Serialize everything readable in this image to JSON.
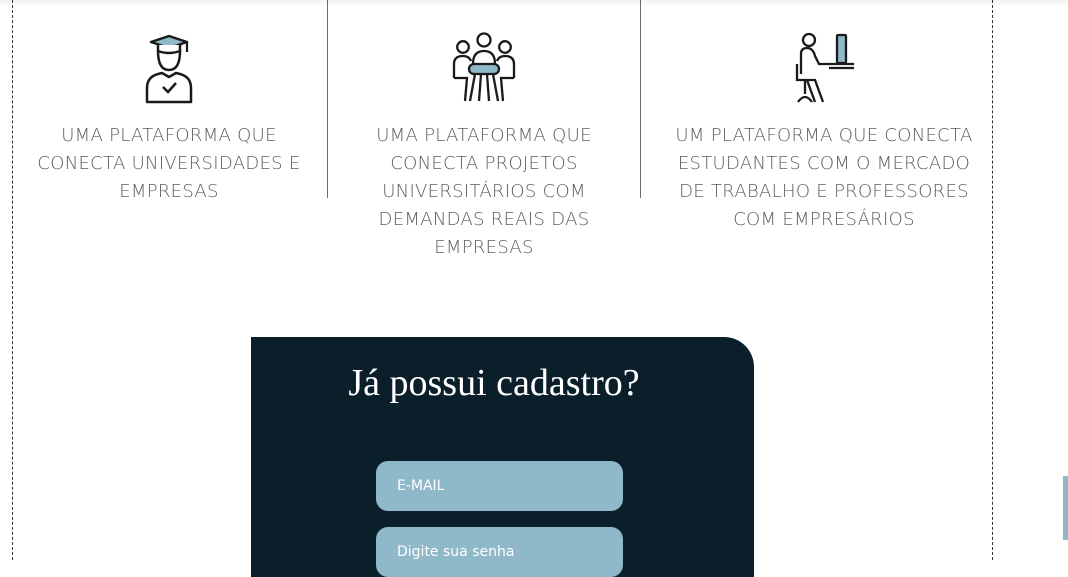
{
  "features": [
    {
      "icon": "graduate-icon",
      "text": "UMA PLATAFORMA QUE CONECTA UNIVERSIDADES E EMPRESAS"
    },
    {
      "icon": "meeting-group-icon",
      "text": "UMA PLATAFORMA QUE CONECTA PROJETOS UNIVERSITÁRIOS COM DEMANDAS REAIS DAS EMPRESAS"
    },
    {
      "icon": "desk-worker-icon",
      "text": "UM PLATAFORMA QUE CONECTA ESTUDANTES COM O MERCADO DE TRABALHO E PROFESSORES COM EMPRESÁRIOS"
    }
  ],
  "login": {
    "title": "Já possui cadastro?",
    "email_placeholder": "E-MAIL",
    "password_placeholder": "Digite sua senha"
  },
  "colors": {
    "card_bg": "#0b1f2a",
    "field_bg": "#8fb8c9",
    "text_gray": "#5c5c5c",
    "divider": "#6b6b6b"
  }
}
